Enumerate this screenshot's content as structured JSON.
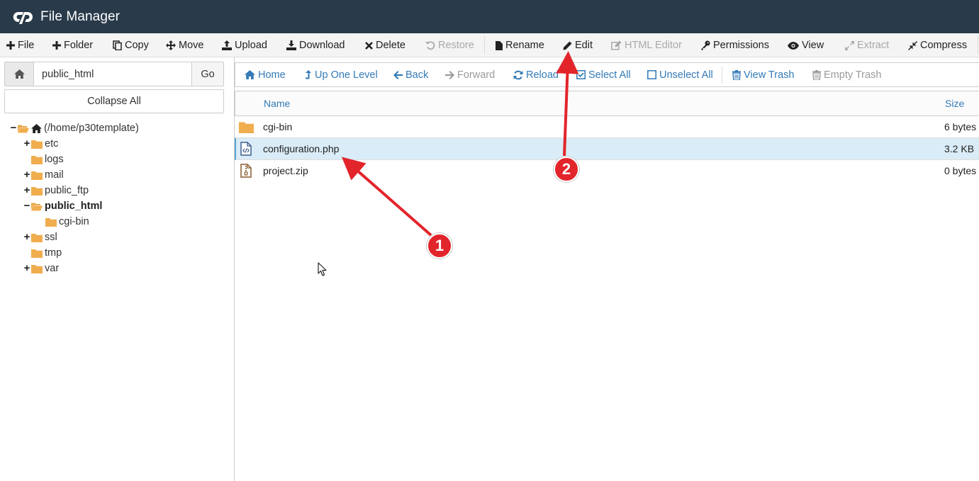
{
  "header": {
    "title": "File Manager",
    "logo": "cpanel-logo"
  },
  "toolbar": {
    "file": "File",
    "folder": "Folder",
    "copy": "Copy",
    "move": "Move",
    "upload": "Upload",
    "download": "Download",
    "delete": "Delete",
    "restore": "Restore",
    "rename": "Rename",
    "edit": "Edit",
    "html_editor": "HTML Editor",
    "permissions": "Permissions",
    "view": "View",
    "extract": "Extract",
    "compress": "Compress"
  },
  "left": {
    "path_value": "public_html",
    "go_label": "Go",
    "collapse_label": "Collapse All",
    "tree": [
      {
        "label": "(/home/p30template)",
        "toggle": "−"
      },
      {
        "label": "etc",
        "toggle": "+"
      },
      {
        "label": "logs",
        "toggle": ""
      },
      {
        "label": "mail",
        "toggle": "+"
      },
      {
        "label": "public_ftp",
        "toggle": "+"
      },
      {
        "label": "public_html",
        "toggle": "−"
      },
      {
        "label": "cgi-bin",
        "toggle": ""
      },
      {
        "label": "ssl",
        "toggle": "+"
      },
      {
        "label": "tmp",
        "toggle": ""
      },
      {
        "label": "var",
        "toggle": "+"
      }
    ]
  },
  "nav": {
    "home": "Home",
    "up_one_level": "Up One Level",
    "back": "Back",
    "forward": "Forward",
    "reload": "Reload",
    "select_all": "Select All",
    "unselect_all": "Unselect All",
    "view_trash": "View Trash",
    "empty_trash": "Empty Trash"
  },
  "table": {
    "columns": {
      "name": "Name",
      "size": "Size"
    },
    "rows": [
      {
        "name": "cgi-bin",
        "size": "6 bytes",
        "icon": "folder-icon"
      },
      {
        "name": "configuration.php",
        "size": "3.2 KB",
        "icon": "code-file-icon"
      },
      {
        "name": "project.zip",
        "size": "0 bytes",
        "icon": "zip-file-icon"
      }
    ]
  },
  "annotations": {
    "step1": "1",
    "step2": "2"
  },
  "colors": {
    "header_bg": "#293a4a",
    "link": "#337ab7",
    "folder": "#f0ad4e",
    "selected_row": "#d9ecf7",
    "annotation": "#e2252b"
  }
}
